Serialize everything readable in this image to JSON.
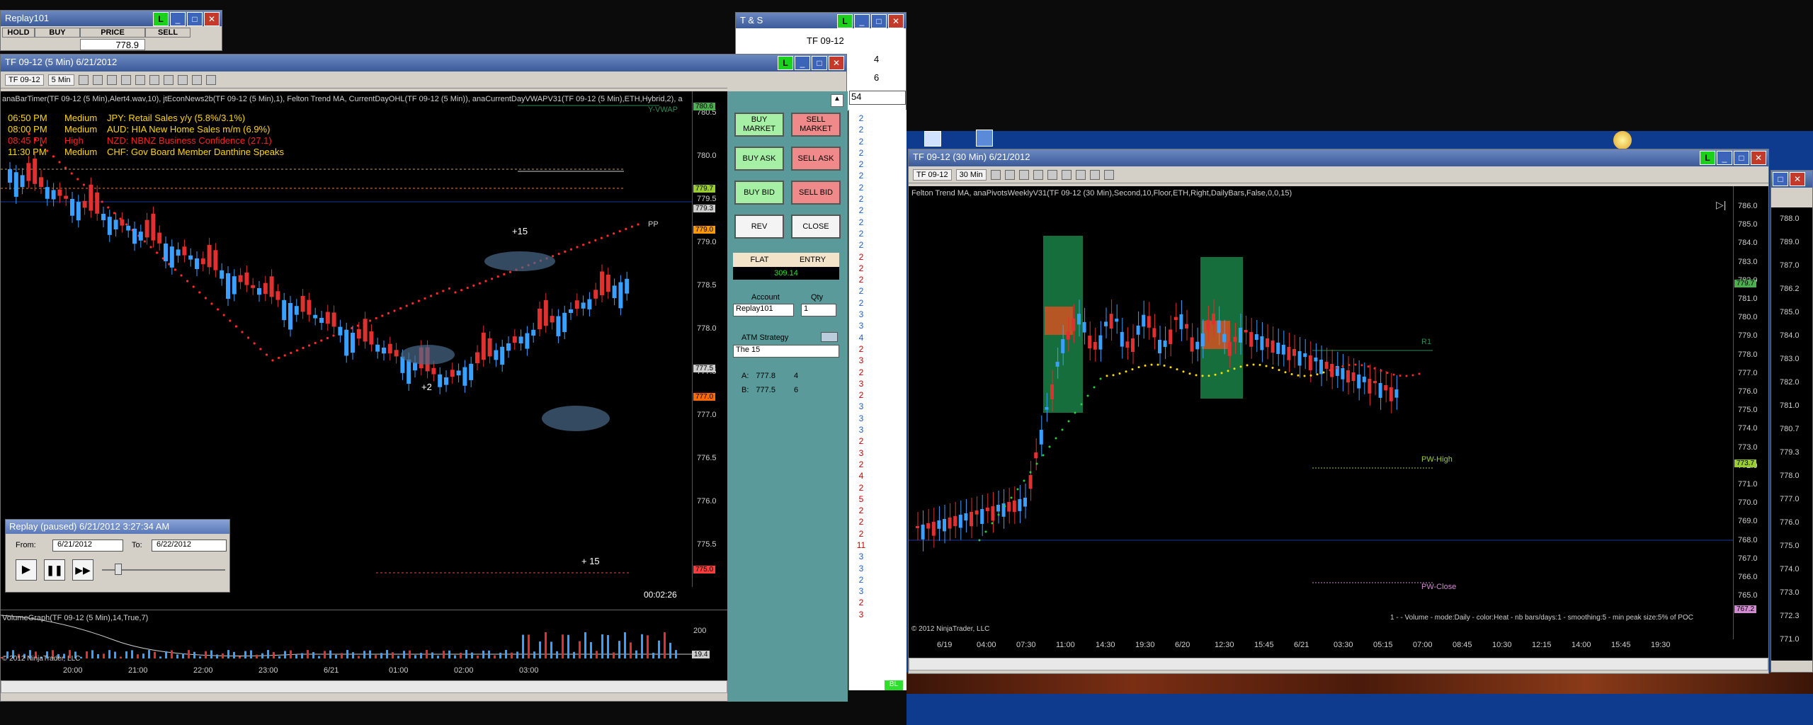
{
  "colors": {
    "accent": "#3b5a99",
    "buy": "#a6f0a6",
    "sell": "#f08a8a"
  },
  "replay_panel": {
    "title": "Replay101",
    "headers": [
      "HOLD",
      "BUY",
      "PRICE",
      "SELL"
    ],
    "price": "778.9"
  },
  "ts_window": {
    "title": "T & S",
    "instrument": "TF 09-12",
    "qty": [
      "4",
      "6",
      "54"
    ]
  },
  "chart5": {
    "title": "TF 09-12 (5 Min)  6/21/2012",
    "instrument": "TF 09-12",
    "interval": "5 Min",
    "indicators": "anaBarTimer(TF 09-12 (5 Min),Alert4.wav,10), jtEconNews2b(TF 09-12 (5 Min),1), Felton Trend MA, CurrentDayOHL(TF 09-12 (5 Min)), anaCurrentDayVWAPV31(TF 09-12 (5 Min),ETH,Hybrid,2), a",
    "news": [
      {
        "time": "06:50 PM",
        "impact": "Medium",
        "text": "JPY: Retail Sales y/y (5.8%/3.1%)",
        "color": "#ffd800"
      },
      {
        "time": "08:00 PM",
        "impact": "Medium",
        "text": "AUD: HIA New Home Sales m/m (6.9%)",
        "color": "#ffd800"
      },
      {
        "time": "08:45 PM",
        "impact": "High",
        "text": "NZD: NBNZ Business Confidence (27.1)",
        "color": "#ff2020"
      },
      {
        "time": "11:30 PM",
        "impact": "Medium",
        "text": "CHF: Gov Board Member Danthine Speaks",
        "color": "#ffd800"
      }
    ],
    "yaxis": [
      "780.5",
      "780.0",
      "779.5",
      "779.0",
      "778.5",
      "778.0",
      "777.5",
      "777.0",
      "776.5",
      "776.0",
      "775.5"
    ],
    "xaxis": [
      "20:00",
      "21:00",
      "22:00",
      "23:00",
      "6/21",
      "01:00",
      "02:00",
      "03:00"
    ],
    "price_tags": [
      {
        "v": "780.6",
        "c": "#4caf50"
      },
      {
        "v": "779.7",
        "c": "#9acd32"
      },
      {
        "v": "779.3",
        "c": "#cccccc"
      },
      {
        "v": "779.0",
        "c": "#ff9900"
      },
      {
        "v": "777.5",
        "c": "#cccccc"
      },
      {
        "v": "777.0",
        "c": "#ff6a00"
      },
      {
        "v": "775.0",
        "c": "#ff3b3b"
      }
    ],
    "labels": {
      "vwap": "Y-VWAP",
      "pp": "PP",
      "p15a": "+15",
      "p2": "+2",
      "p15b": "+ 15",
      "timer": "00:02:26"
    },
    "copyright": "© 2012 NinjaTrader, LLC",
    "volume": {
      "label": "VolumeGraph(TF 09-12 (5 Min),14,True,7)",
      "axis": "200",
      "tag": "19.4"
    }
  },
  "replay": {
    "title": "Replay (paused) 6/21/2012 3:27:34 AM",
    "from_label": "From:",
    "from": "6/21/2012",
    "to_label": "To:",
    "to": "6/22/2012"
  },
  "order_panel": {
    "buttons": [
      "BUY MARKET",
      "SELL MARKET",
      "BUY ASK",
      "SELL ASK",
      "BUY BID",
      "SELL BID",
      "REV",
      "CLOSE"
    ],
    "flat": "FLAT",
    "entry": "ENTRY",
    "pnl": "309.14",
    "account_label": "Account",
    "qty_label": "Qty",
    "account": "Replay101",
    "qty": "1",
    "atm_label": "ATM Strategy",
    "atm": "The 15",
    "rows": [
      {
        "k": "A:",
        "v": "777.8",
        "q": "4"
      },
      {
        "k": "B:",
        "v": "777.5",
        "q": "6"
      }
    ]
  },
  "dom": {
    "values": [
      {
        "v": "2",
        "c": "b"
      },
      {
        "v": "2",
        "c": "b"
      },
      {
        "v": "2",
        "c": "b"
      },
      {
        "v": "2",
        "c": "b"
      },
      {
        "v": "2",
        "c": "b"
      },
      {
        "v": "2",
        "c": "b"
      },
      {
        "v": "2",
        "c": "b"
      },
      {
        "v": "2",
        "c": "b"
      },
      {
        "v": "2",
        "c": "b"
      },
      {
        "v": "2",
        "c": "b"
      },
      {
        "v": "2",
        "c": "b"
      },
      {
        "v": "2",
        "c": "b"
      },
      {
        "v": "2",
        "c": "r"
      },
      {
        "v": "2",
        "c": "r"
      },
      {
        "v": "2",
        "c": "r"
      },
      {
        "v": "2",
        "c": "b"
      },
      {
        "v": "2",
        "c": "b"
      },
      {
        "v": "3",
        "c": "b"
      },
      {
        "v": "3",
        "c": "b"
      },
      {
        "v": "4",
        "c": "b"
      },
      {
        "v": "2",
        "c": "r"
      },
      {
        "v": "3",
        "c": "r"
      },
      {
        "v": "2",
        "c": "r"
      },
      {
        "v": "3",
        "c": "r"
      },
      {
        "v": "2",
        "c": "r"
      },
      {
        "v": "3",
        "c": "b"
      },
      {
        "v": "3",
        "c": "b"
      },
      {
        "v": "3",
        "c": "b"
      },
      {
        "v": "2",
        "c": "r"
      },
      {
        "v": "3",
        "c": "r"
      },
      {
        "v": "2",
        "c": "r"
      },
      {
        "v": "4",
        "c": "r"
      },
      {
        "v": "2",
        "c": "r"
      },
      {
        "v": "5",
        "c": "r"
      },
      {
        "v": "2",
        "c": "r"
      },
      {
        "v": "2",
        "c": "r"
      },
      {
        "v": "2",
        "c": "r"
      },
      {
        "v": "11",
        "c": "r"
      },
      {
        "v": "3",
        "c": "b"
      },
      {
        "v": "3",
        "c": "b"
      },
      {
        "v": "2",
        "c": "b"
      },
      {
        "v": "3",
        "c": "b"
      },
      {
        "v": "2",
        "c": "r"
      },
      {
        "v": "3",
        "c": "r"
      }
    ],
    "bl": "BL"
  },
  "chart30": {
    "title": "TF 09-12 (30 Min)  6/21/2012",
    "instrument": "TF 09-12",
    "interval": "30 Min",
    "indicators": "Felton Trend MA, anaPivotsWeeklyV31(TF 09-12 (30 Min),Second,10,Floor,ETH,Right,DailyBars,False,0,0,15)",
    "yaxis": [
      "786.0",
      "785.0",
      "784.0",
      "783.0",
      "782.0",
      "781.0",
      "780.0",
      "779.0",
      "778.0",
      "777.0",
      "776.0",
      "775.0",
      "774.0",
      "773.0",
      "772.0",
      "771.0",
      "770.0",
      "769.0",
      "768.0",
      "767.0",
      "766.0",
      "765.0"
    ],
    "xaxis": [
      "6/19",
      "04:00",
      "07:30",
      "11:00",
      "14:30",
      "19:30",
      "6/20",
      "12:30",
      "15:45",
      "6/21",
      "03:30",
      "05:15",
      "07:00",
      "08:45",
      "10:30",
      "12:15",
      "14:00",
      "15:45",
      "19:30"
    ],
    "tags": [
      {
        "v": "779.7",
        "c": "#4caf50"
      },
      {
        "v": "773.7",
        "c": "#9acd32"
      },
      {
        "v": "767.2",
        "c": "#d08ad0"
      }
    ],
    "labels": {
      "r1": "R1",
      "pwhigh": "PW-High",
      "pwclose": "PW-Close"
    },
    "footer": "1 -  - Volume - mode:Daily - color:Heat - nb bars/days:1 - smoothing:5 - min peak size:5% of POC",
    "copyright": "© 2012 NinjaTrader, LLC"
  },
  "side_axis": [
    "788.0",
    "789.0",
    "787.0",
    "786.2",
    "785.0",
    "784.0",
    "783.0",
    "782.0",
    "781.0",
    "780.7",
    "779.3",
    "778.0",
    "777.0",
    "776.0",
    "775.0",
    "774.0",
    "773.0",
    "772.3",
    "771.0"
  ]
}
